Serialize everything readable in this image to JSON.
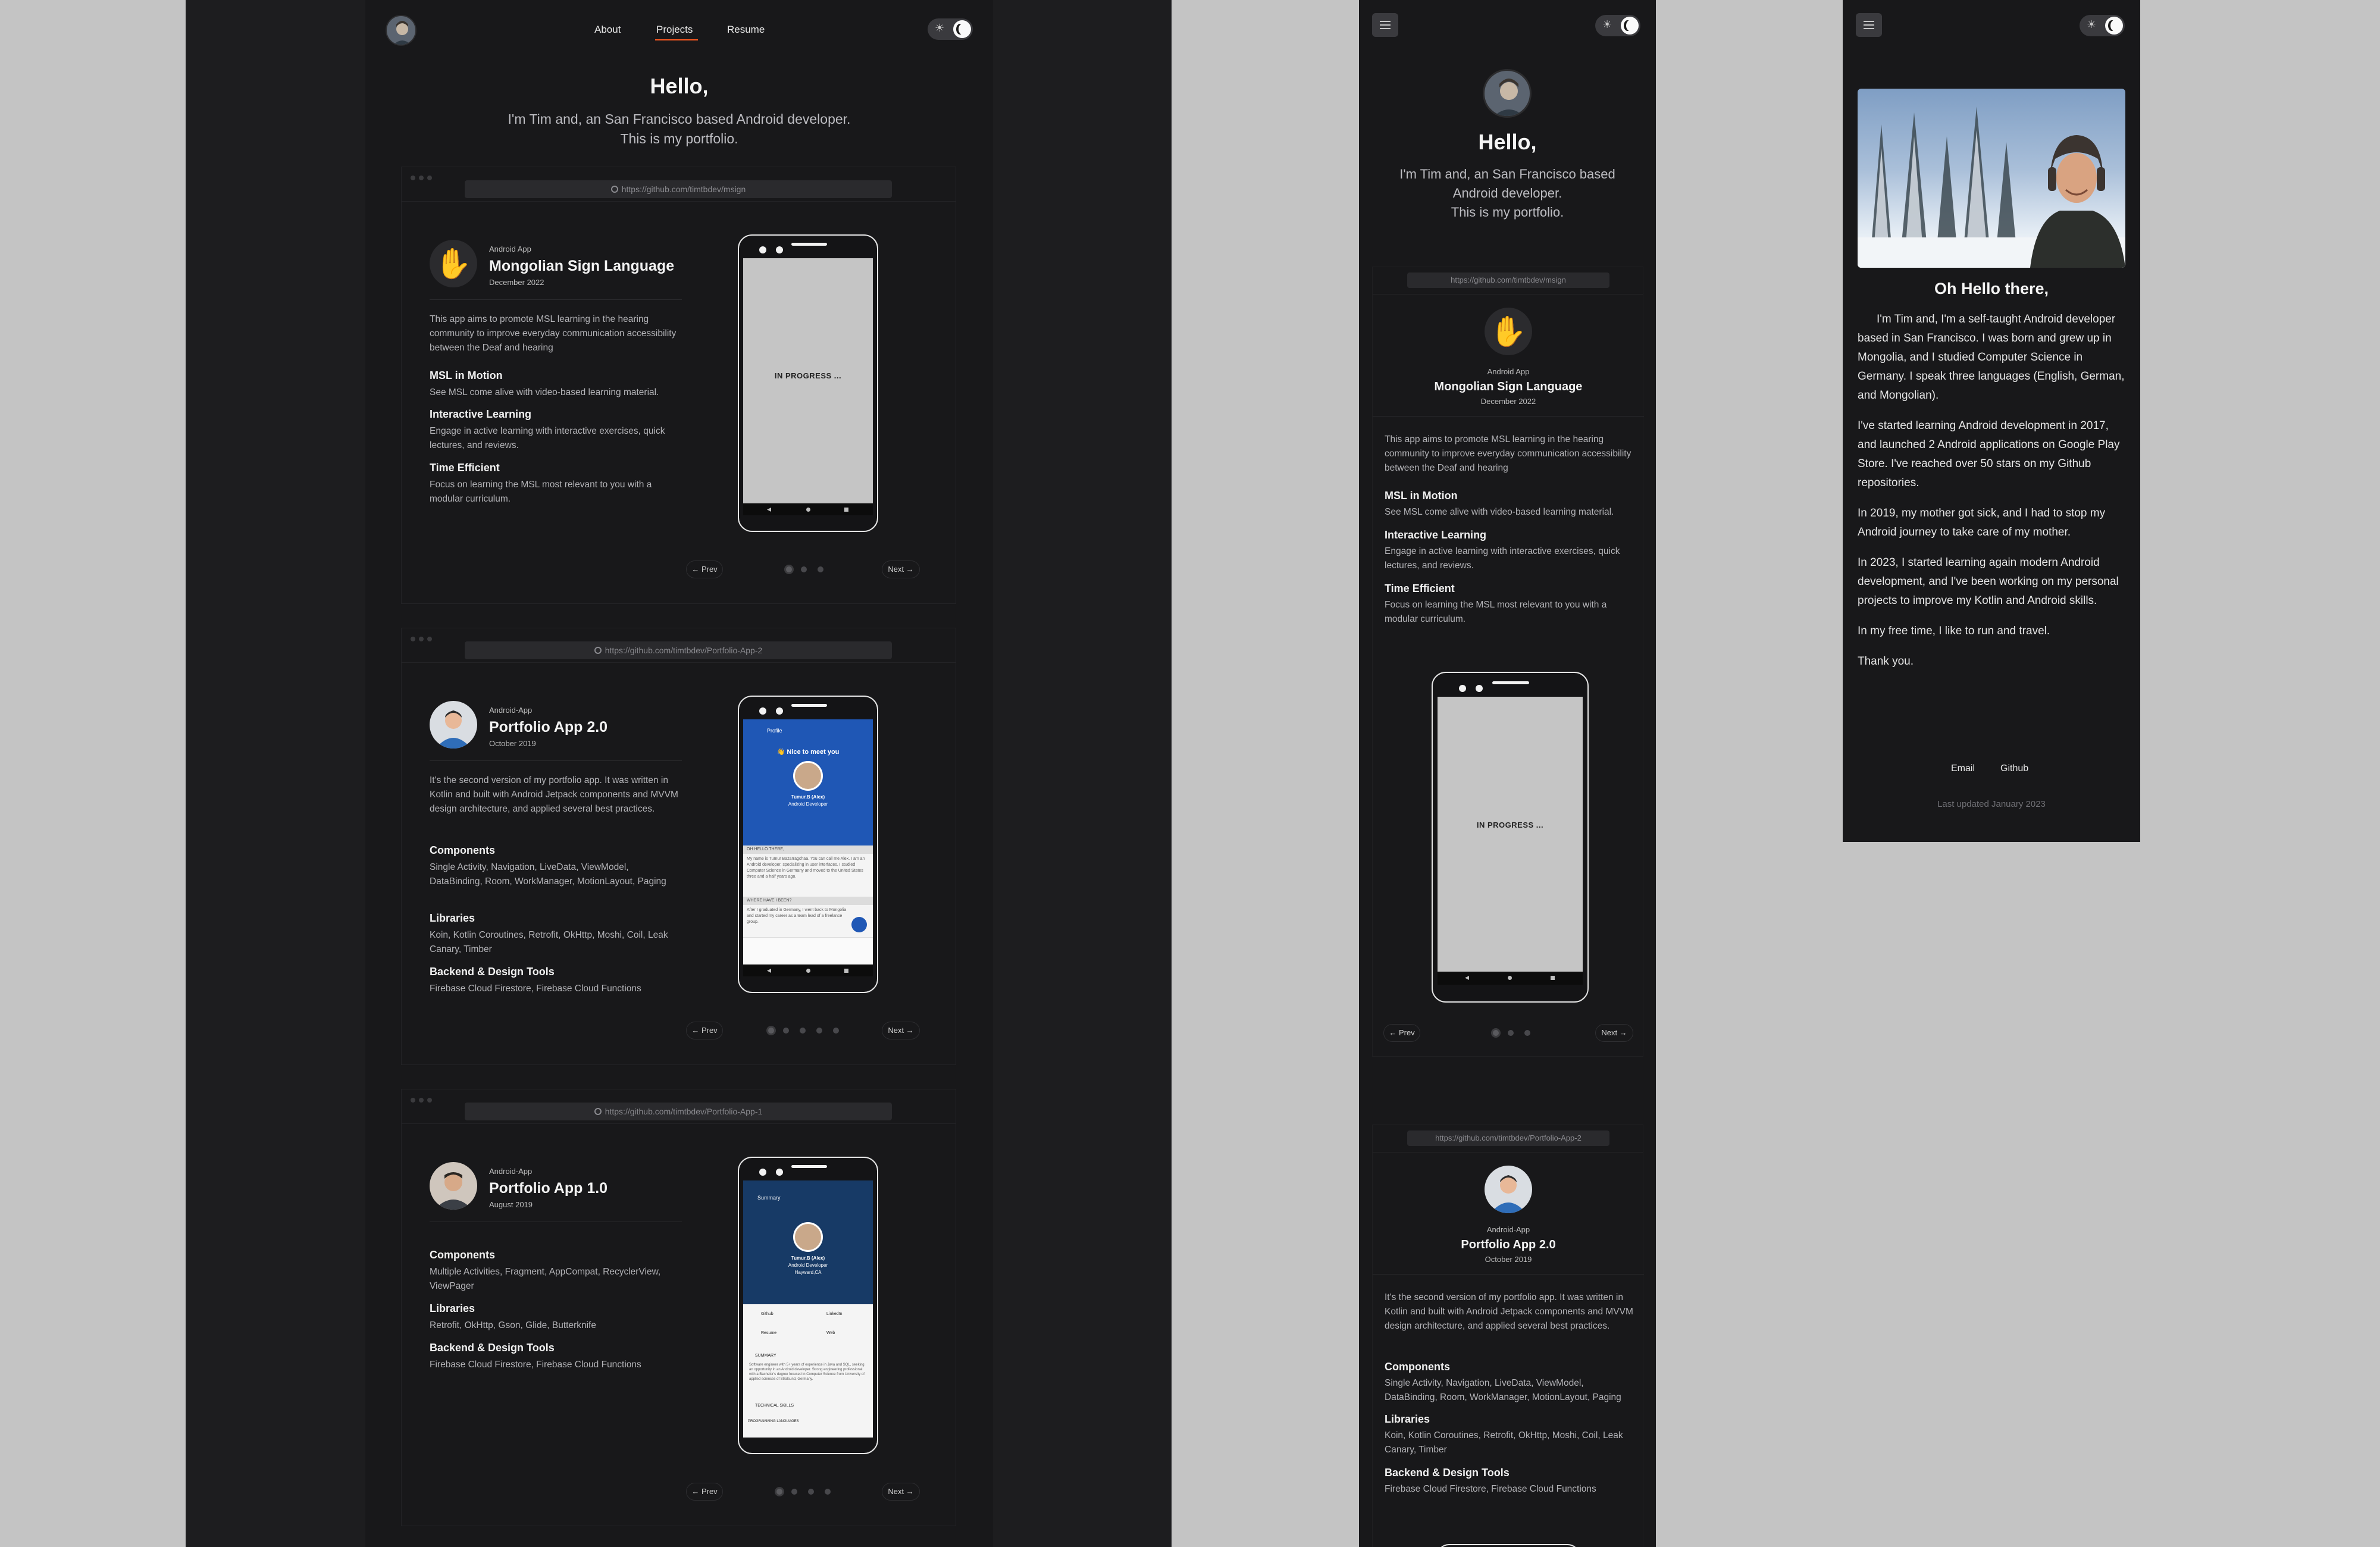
{
  "site": {
    "nav": {
      "about": "About",
      "projects": "Projects",
      "resume": "Resume"
    },
    "hero": {
      "hello": "Hello,",
      "line1": "I'm Tim and, an San Francisco based Android developer.",
      "line2": "This is my portfolio.",
      "mobile_line1": "I'm Tim and, an San Francisco based",
      "mobile_line2": "Android developer.",
      "mobile_line3": "This is my portfolio."
    },
    "theme_toggle": {
      "sun": "☀",
      "mode": "dark"
    },
    "colors": {
      "page_bg": "#1d1d1f",
      "card_bg": "#18181a",
      "accent_underline": "#ff5a1f",
      "outside": "#c4c4c4"
    }
  },
  "projects": [
    {
      "url": "https://github.com/timtbdev/msign",
      "kind": "Android App",
      "title": "Mongolian Sign Language",
      "date": "December 2022",
      "icon": "waving-hand-icon",
      "description": "This app aims to promote MSL learning in the hearing community to improve everyday communication accessibility between the Deaf and hearing",
      "features": [
        {
          "title": "MSL in Motion",
          "text": "See MSL come alive with video-based learning material."
        },
        {
          "title": "Interactive Learning",
          "text": "Engage in active learning with interactive exercises, quick lectures, and reviews."
        },
        {
          "title": "Time Efficient",
          "text": "Focus on learning the MSL most relevant to you with a modular curriculum."
        }
      ],
      "screen_text": "IN PROGRESS ...",
      "prev": "← Prev",
      "next": "Next →",
      "slides": 3
    },
    {
      "url": "https://github.com/timtbdev/Portfolio-App-2",
      "kind": "Android-App",
      "title": "Portfolio App 2.0",
      "date": "October 2019",
      "icon": "avatar-cartoon-icon",
      "description": "It's the second version of my portfolio app. It was written in Kotlin and built with Android Jetpack components and MVVM design architecture, and applied several best practices.",
      "features": [
        {
          "title": "Components",
          "text": "Single Activity, Navigation, LiveData, ViewModel, DataBinding, Room, WorkManager, MotionLayout, Paging"
        },
        {
          "title": "Libraries",
          "text": "Koin, Kotlin Coroutines, Retrofit, OkHttp, Moshi, Coil, Leak Canary, Timber"
        },
        {
          "title": "Backend & Design Tools",
          "text": "Firebase Cloud Firestore, Firebase Cloud Functions"
        }
      ],
      "screen": {
        "bar": "Profile",
        "greeting": "👋 Nice to meet you",
        "name": "Tumur.B (Alex)",
        "role": "Android Developer",
        "section1": "OH HELLO THERE,",
        "body1": "My name is Tumur Bazarragchaa. You can call me Alex. I am an Android developer, specializing in user interfaces. I studied Computer Science in Germany and moved to the United States three and a half years ago.",
        "section2": "WHERE HAVE I BEEN?",
        "body2": "After I graduated in Germany, I went back to Mongolia and started my career as a team lead of a freelance group."
      },
      "prev": "← Prev",
      "next": "Next →",
      "slides": 5
    },
    {
      "url": "https://github.com/timtbdev/Portfolio-App-1",
      "kind": "Android-App",
      "title": "Portfolio App 1.0",
      "date": "August 2019",
      "icon": "avatar-photo-icon",
      "features": [
        {
          "title": "Components",
          "text": "Multiple Activities, Fragment, AppCompat, RecyclerView, ViewPager"
        },
        {
          "title": "Libraries",
          "text": "Retrofit, OkHttp, Gson, Glide, Butterknife"
        },
        {
          "title": "Backend & Design Tools",
          "text": "Firebase Cloud Firestore, Firebase Cloud Functions"
        }
      ],
      "screen": {
        "bar": "Summary",
        "name": "Tumur.B (Alex)",
        "role": "Android Developer",
        "loc": "Hayward,CA",
        "github": "Github",
        "linkedin": "LinkedIn",
        "resume": "Resume",
        "web": "Web",
        "summary": "SUMMARY",
        "summary_text": "Software engineer with 5+ years of experience in Java and SQL, seeking an opportunity in an Android developer. Strong engineering professional with a Bachelor's degree focused in Computer Science from University of applied sciences of Stralsund, Germany.",
        "tech": "TECHNICAL SKILLS",
        "lang": "PROGRAMMING LANGUAGES"
      },
      "prev": "← Prev",
      "next": "Next →",
      "slides": 4
    }
  ],
  "about": {
    "heading": "Oh Hello there,",
    "paragraphs": [
      "I'm Tim and, I'm a self-taught Android developer based in San Francisco. I was born and grew up in Mongolia, and I studied Computer Science in Germany. I speak three languages (English, German, and Mongolian).",
      "I've started learning Android development in 2017, and launched 2 Android applications on Google Play Store. I've reached over 50 stars on my Github repositories.",
      "In 2019, my mother got sick, and I had to stop my Android journey to take care of my mother.",
      "In 2023, I started learning again modern Android development, and I've been working on my personal projects to improve my Kotlin and Android skills.",
      "In my free time, I like to run and travel.",
      "Thank you."
    ],
    "footer_email": "Email",
    "footer_github": "Github",
    "updated": "Last updated January 2023"
  }
}
